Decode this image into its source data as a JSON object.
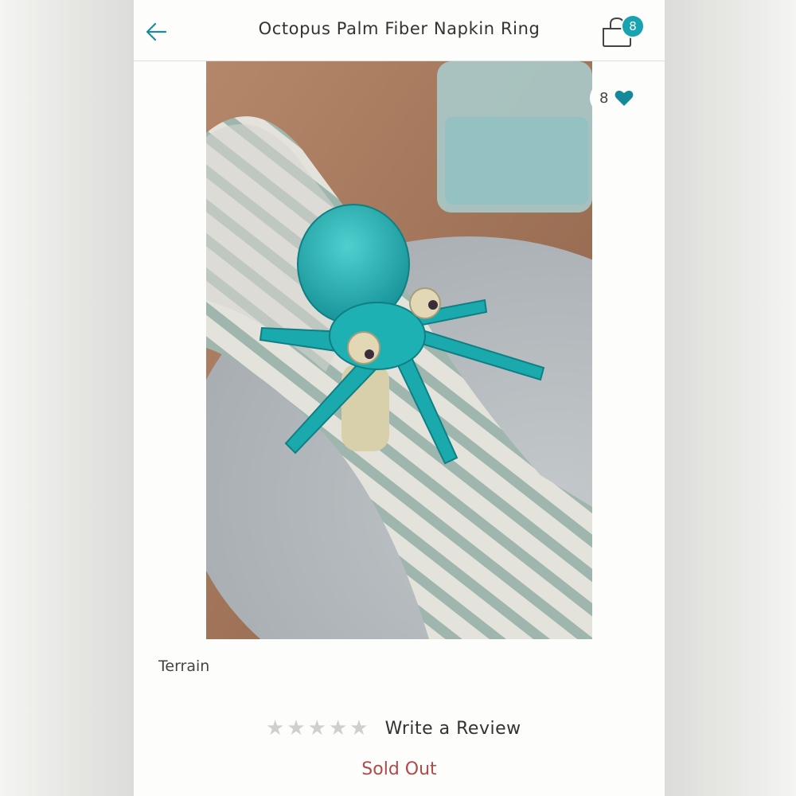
{
  "header": {
    "title": "Octopus Palm Fiber Napkin Ring",
    "back_icon": "arrow-left-icon",
    "cart_icon": "shopping-bag-icon",
    "cart_count": "8",
    "accent_color": "#18a3b1"
  },
  "product": {
    "image_alt": "Turquoise woven octopus napkin ring on a striped linen napkin",
    "like_count": "8",
    "like_icon": "heart-icon",
    "brand": "Terrain",
    "rating_stars": 5,
    "rating_filled": 0,
    "review_link": "Write a Review",
    "status": "Sold Out",
    "status_color": "#b04a4a"
  }
}
